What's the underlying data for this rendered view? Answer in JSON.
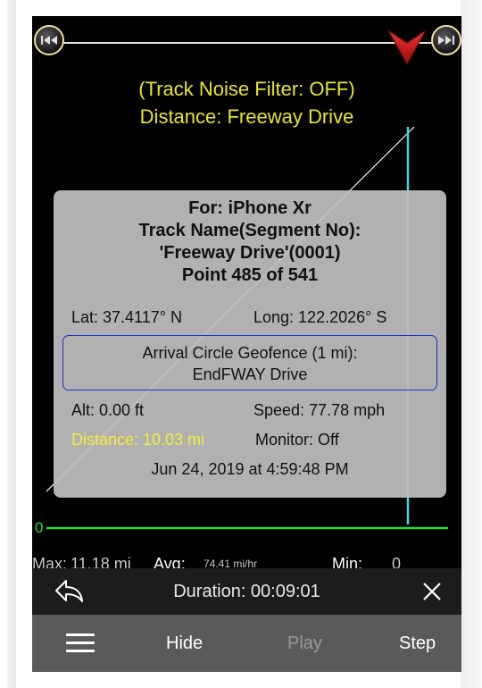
{
  "header": {
    "filter_status": "(Track Noise Filter: OFF)",
    "distance_title": "Distance: Freeway Drive"
  },
  "info": {
    "device": "For: iPhone Xr",
    "track_name_label": "Track Name(Segment No):",
    "track_name": "'Freeway Drive'(0001)",
    "point": "Point 485 of 541",
    "lat": "Lat: 37.4117° N",
    "long": "Long: 122.2026° S",
    "geofence_title": "Arrival Circle Geofence (1 mi):",
    "geofence_name": "EndFWAY Drive",
    "alt": "Alt:  0.00 ft",
    "speed": "Speed:  77.78 mph",
    "distance": "Distance: 10.03 mi",
    "monitor": "Monitor: Off",
    "timestamp": "Jun 24, 2019 at 4:59:48 PM"
  },
  "chart": {
    "zero_label": "0"
  },
  "stats": {
    "max_label": "Max:",
    "max_value": "11.18 mi",
    "avg_label": "Avg:",
    "avg_value": "74.41 mi/hr",
    "min_label": "Min:",
    "min_value": "0"
  },
  "controls": {
    "duration": "Duration: 00:09:01",
    "hide_label": "Hide",
    "play_label": "Play",
    "step_label": "Step"
  },
  "playback": {
    "current_point": 485,
    "total_points": 541
  },
  "icons": {
    "prev": "skip-previous-icon",
    "next": "skip-next-icon",
    "marker": "position-marker-icon",
    "back": "back-arrow-icon",
    "close": "close-icon",
    "menu": "hamburger-menu-icon"
  },
  "colors": {
    "header_text": "#e8e624",
    "chart_line": "#28e028",
    "cursor_line": "#3fd6e0",
    "marker": "#d81818",
    "geofence_border": "#1c2fc8",
    "panel_bg": "#bebebe"
  }
}
